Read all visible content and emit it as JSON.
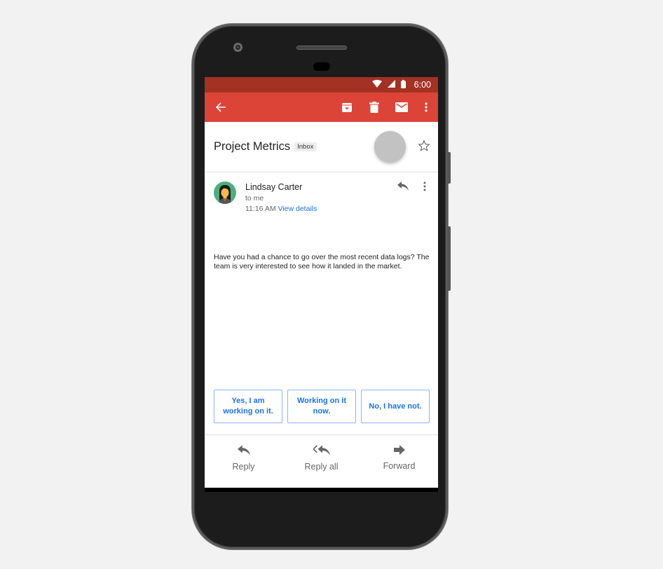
{
  "status_bar": {
    "time": "6:00",
    "icons": [
      "wifi-icon",
      "signal-icon",
      "battery-icon"
    ]
  },
  "app_bar": {
    "back_icon": "arrow-left-icon",
    "actions": [
      "archive-icon",
      "delete-icon",
      "mail-icon",
      "more-vert-icon"
    ]
  },
  "email": {
    "subject": "Project Metrics",
    "label": "Inbox",
    "starred": false,
    "sender": {
      "name": "Lindsay Carter",
      "to": "to me",
      "time": "11:16 AM",
      "view_details": "View details"
    },
    "body": "Have you had a chance to go over the most recent data logs? The team is very interested to see how it landed in the market."
  },
  "smart_replies": [
    "Yes, I am working on it.",
    "Working on it now.",
    "No, I have not."
  ],
  "actions": [
    {
      "label": "Reply",
      "icon": "reply-icon"
    },
    {
      "label": "Reply all",
      "icon": "reply-all-icon"
    },
    {
      "label": "Forward",
      "icon": "forward-icon"
    }
  ],
  "colors": {
    "status_bar": "#a33124",
    "app_bar": "#db4437",
    "link": "#1a73e8",
    "avatar_bg": "#4caf7d"
  }
}
